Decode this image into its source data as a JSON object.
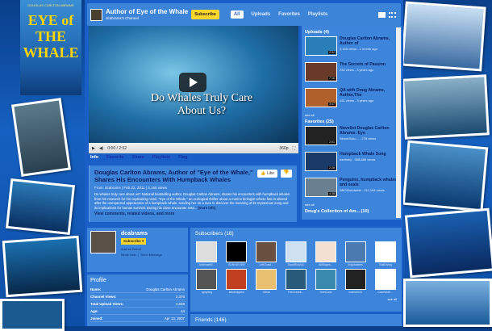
{
  "book": {
    "author": "DOUGLAS CARLTON ABRAMS",
    "title_lines": [
      "EYE of",
      "THE",
      "WHALE"
    ]
  },
  "header": {
    "title": "Author of Eye of the Whale",
    "channel": "dcabrams's Channel",
    "subscribe": "Subscribe",
    "tabs": [
      "All",
      "Uploads",
      "Favorites",
      "Playlists"
    ]
  },
  "video": {
    "overlay_text": "Do Whales Truly Care About Us?",
    "time": "0:00 / 2:52",
    "quality": "360p"
  },
  "info_tabs": [
    "Info",
    "Favorite",
    "Share",
    "Playlists",
    "Flag"
  ],
  "info": {
    "title": "Douglas Carlton Abrams, Author of \"Eye of the Whale,\" Shares His Encounters With Humpback Whales",
    "from": "From: dcabrams | Feb 22, 2011 | 3,165 views",
    "description": "Do whales truly care about us? National bestselling author, Douglas Carlton Abrams, shares his encounters with humpback whales from his research for his captivating novel, \"Eye of the Whale,\" an ecological thriller about a marine biologist whose fate is altered after the unexpected appearance of a humpback whale, sending her on a race to discover the meaning of its mysterious song and its implications for human survival. During his close encounter rese...",
    "more_info": "(more info)",
    "like": "Like",
    "view_more": "View comments, related videos, and more"
  },
  "sidebar": {
    "uploads_title": "Uploads (4)",
    "uploads": [
      {
        "title": "Douglas Carlton Abrams, Author of",
        "meta": "3,165 views - 1 month ago",
        "dur": "2:52",
        "color": "#2a7fb8"
      },
      {
        "title": "The Secrets of Passion",
        "meta": "232 views - 3 years ago",
        "dur": "7:16",
        "color": "#6a3a28"
      },
      {
        "title": "QA with Doug Abrams, Author,The",
        "meta": "431 views - 3 years ago",
        "dur": "3:47",
        "color": "#b0602a"
      }
    ],
    "see_all": "see all",
    "favorites_title": "Favorites (25)",
    "favorites": [
      {
        "title": "Novelist Douglas Carlton Abrams: Eye",
        "meta": "SimonSchu... - 278 views",
        "dur": "2:01",
        "color": "#222"
      },
      {
        "title": "Humpback Whale Song",
        "meta": "earthsky - 368,686 views",
        "dur": "2:28",
        "color": "#1a3a6a"
      },
      {
        "title": "Penguins, humpback whales and seals",
        "meta": "BBCWorldwide - 112,164 views",
        "dur": "4:38",
        "color": "#6a8090"
      }
    ],
    "playlist_title": "Doug's Collection of Am... (10)"
  },
  "profile": {
    "username": "dcabrams",
    "subscribe": "Subscribe",
    "add_friend": "Add as Friend",
    "block": "Block User",
    "send": "Send Message",
    "title": "Profile",
    "rows": [
      {
        "k": "Name:",
        "v": "Douglas Carlton Abrams"
      },
      {
        "k": "Channel Views:",
        "v": "2,376"
      },
      {
        "k": "Total Upload Views:",
        "v": "4,048"
      },
      {
        "k": "Age:",
        "v": "44"
      },
      {
        "k": "Joined:",
        "v": "Apr 13, 2007"
      }
    ]
  },
  "subscribers": {
    "title": "Subscribers (18)",
    "see_all": "see all",
    "items": [
      {
        "n": "AmbroseW...",
        "c": "#ddd"
      },
      {
        "n": "SUNV4EVER",
        "c": "#000"
      },
      {
        "n": "LeftCoast...",
        "c": "#6a5040"
      },
      {
        "n": "BookRixUSA",
        "c": "#cfe0f0"
      },
      {
        "n": "AllStages...",
        "c": "#f4e0d0"
      },
      {
        "n": "4egofwaters",
        "c": "#4a7ab0"
      },
      {
        "n": "TotalDiving",
        "c": "#fff"
      },
      {
        "n": "rgrayling",
        "c": "#555"
      },
      {
        "n": "lalivenagann",
        "c": "#c04020"
      },
      {
        "n": "42ivia",
        "c": "#e8c070"
      },
      {
        "n": "TheOceanL...",
        "c": "#2a5a7a"
      },
      {
        "n": "JohnCaus",
        "c": "#3a8ab0"
      },
      {
        "n": "matrix2021",
        "c": "#222"
      },
      {
        "n": "CaveWolfi...",
        "c": "#fff"
      }
    ]
  },
  "friends": {
    "title": "Friends (146)"
  }
}
